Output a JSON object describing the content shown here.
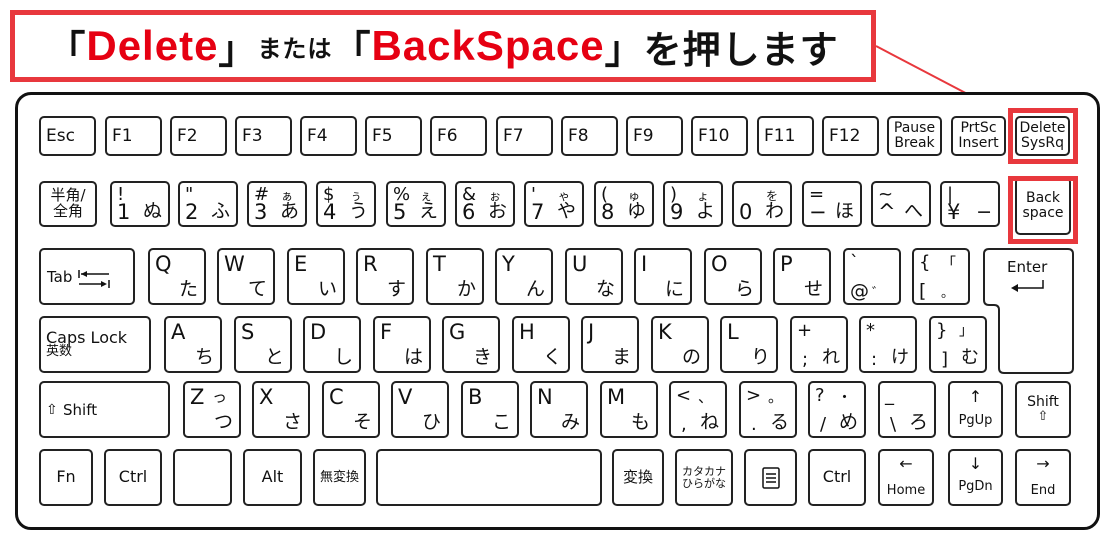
{
  "banner": {
    "open1": "「",
    "key1": "Delete",
    "close1": "」",
    "or": "または",
    "open2": "「",
    "key2": "BackSpace",
    "close2": "」",
    "action": "を押します"
  },
  "colors": {
    "highlight": "#e8383d",
    "keyword": "#e60012",
    "key_border": "#222222"
  },
  "row0": [
    "Esc",
    "F1",
    "F2",
    "F3",
    "F4",
    "F5",
    "F6",
    "F7",
    "F8",
    "F9",
    "F10",
    "F11",
    "F12"
  ],
  "row0_two": [
    {
      "l1": "Pause",
      "l2": "Break"
    },
    {
      "l1": "PrtSc",
      "l2": "Insert"
    },
    {
      "l1": "Delete",
      "l2": "SysRq"
    }
  ],
  "row1": {
    "hankaku": {
      "l1": "半角/",
      "l2": "全角"
    },
    "keys": [
      {
        "tl": "!",
        "tr": "",
        "bl": "1",
        "br": "ぬ"
      },
      {
        "tl": "\"",
        "tr": "",
        "bl": "2",
        "br": "ふ"
      },
      {
        "tl": "#",
        "tr": "ぁ",
        "bl": "3",
        "br": "あ"
      },
      {
        "tl": "$",
        "tr": "ぅ",
        "bl": "4",
        "br": "う"
      },
      {
        "tl": "%",
        "tr": "ぇ",
        "bl": "5",
        "br": "え"
      },
      {
        "tl": "&",
        "tr": "ぉ",
        "bl": "6",
        "br": "お"
      },
      {
        "tl": "'",
        "tr": "ゃ",
        "bl": "7",
        "br": "や"
      },
      {
        "tl": "(",
        "tr": "ゅ",
        "bl": "8",
        "br": "ゆ"
      },
      {
        "tl": ")",
        "tr": "ょ",
        "bl": "9",
        "br": "よ"
      },
      {
        "tl": "",
        "tr": "を",
        "bl": "0",
        "br": "わ"
      },
      {
        "tl": "=",
        "tr": "",
        "bl": "−",
        "br": "ほ"
      },
      {
        "tl": "~",
        "tr": "",
        "bl": "^",
        "br": "へ"
      },
      {
        "tl": "|",
        "tr": "",
        "bl": "¥",
        "br": "−"
      }
    ],
    "backspace": {
      "l1": "Back",
      "l2": "space"
    }
  },
  "row2": {
    "tab": "Tab",
    "keys": [
      {
        "tl": "Q",
        "br": "た"
      },
      {
        "tl": "W",
        "br": "て"
      },
      {
        "tl": "E",
        "br": "い"
      },
      {
        "tl": "R",
        "br": "す"
      },
      {
        "tl": "T",
        "br": "か"
      },
      {
        "tl": "Y",
        "br": "ん"
      },
      {
        "tl": "U",
        "br": "な"
      },
      {
        "tl": "I",
        "br": "に"
      },
      {
        "tl": "O",
        "br": "ら"
      },
      {
        "tl": "P",
        "br": "せ"
      },
      {
        "tl": "`",
        "tr": "",
        "bl": "@",
        "br": "゛"
      },
      {
        "tl": "{",
        "tr": "「",
        "bl": "[",
        "br": "。"
      }
    ],
    "enter": "Enter"
  },
  "row3": {
    "caps": {
      "l1": "Caps Lock",
      "l2": "英数"
    },
    "keys": [
      {
        "tl": "A",
        "br": "ち"
      },
      {
        "tl": "S",
        "br": "と"
      },
      {
        "tl": "D",
        "br": "し"
      },
      {
        "tl": "F",
        "br": "は"
      },
      {
        "tl": "G",
        "br": "き"
      },
      {
        "tl": "H",
        "br": "く"
      },
      {
        "tl": "J",
        "br": "ま"
      },
      {
        "tl": "K",
        "br": "の"
      },
      {
        "tl": "L",
        "br": "り"
      },
      {
        "tl": "+",
        "tr": "",
        "bl": ";",
        "br": "れ"
      },
      {
        "tl": "*",
        "tr": "",
        "bl": ":",
        "br": "け"
      },
      {
        "tl": "}",
        "tr": "」",
        "bl": "]",
        "br": "む"
      }
    ]
  },
  "row4": {
    "lshift": "Shift",
    "keys": [
      {
        "tl": "Z",
        "tr": "っ",
        "br": "つ"
      },
      {
        "tl": "X",
        "br": "さ"
      },
      {
        "tl": "C",
        "br": "そ"
      },
      {
        "tl": "V",
        "br": "ひ"
      },
      {
        "tl": "B",
        "br": "こ"
      },
      {
        "tl": "N",
        "br": "み"
      },
      {
        "tl": "M",
        "br": "も"
      },
      {
        "tl": "<",
        "tr": "、",
        "bl": ",",
        "br": "ね"
      },
      {
        "tl": ">",
        "tr": "。",
        "bl": ".",
        "br": "る"
      },
      {
        "tl": "?",
        "tr": "・",
        "bl": "/",
        "br": "め"
      },
      {
        "tl": "_",
        "tr": "",
        "bl": "\\",
        "br": "ろ"
      }
    ],
    "pgup": "PgUp",
    "rshift": "Shift"
  },
  "row5": {
    "fn": "Fn",
    "lctrl": "Ctrl",
    "win": "",
    "alt": "Alt",
    "muhenkan": "無変換",
    "space": "",
    "henkan": "変換",
    "kana": {
      "l1": "カタカナ",
      "l2": "ひらがな"
    },
    "rctrl": "Ctrl",
    "home": "Home",
    "pgdn": "PgDn",
    "end": "End"
  }
}
